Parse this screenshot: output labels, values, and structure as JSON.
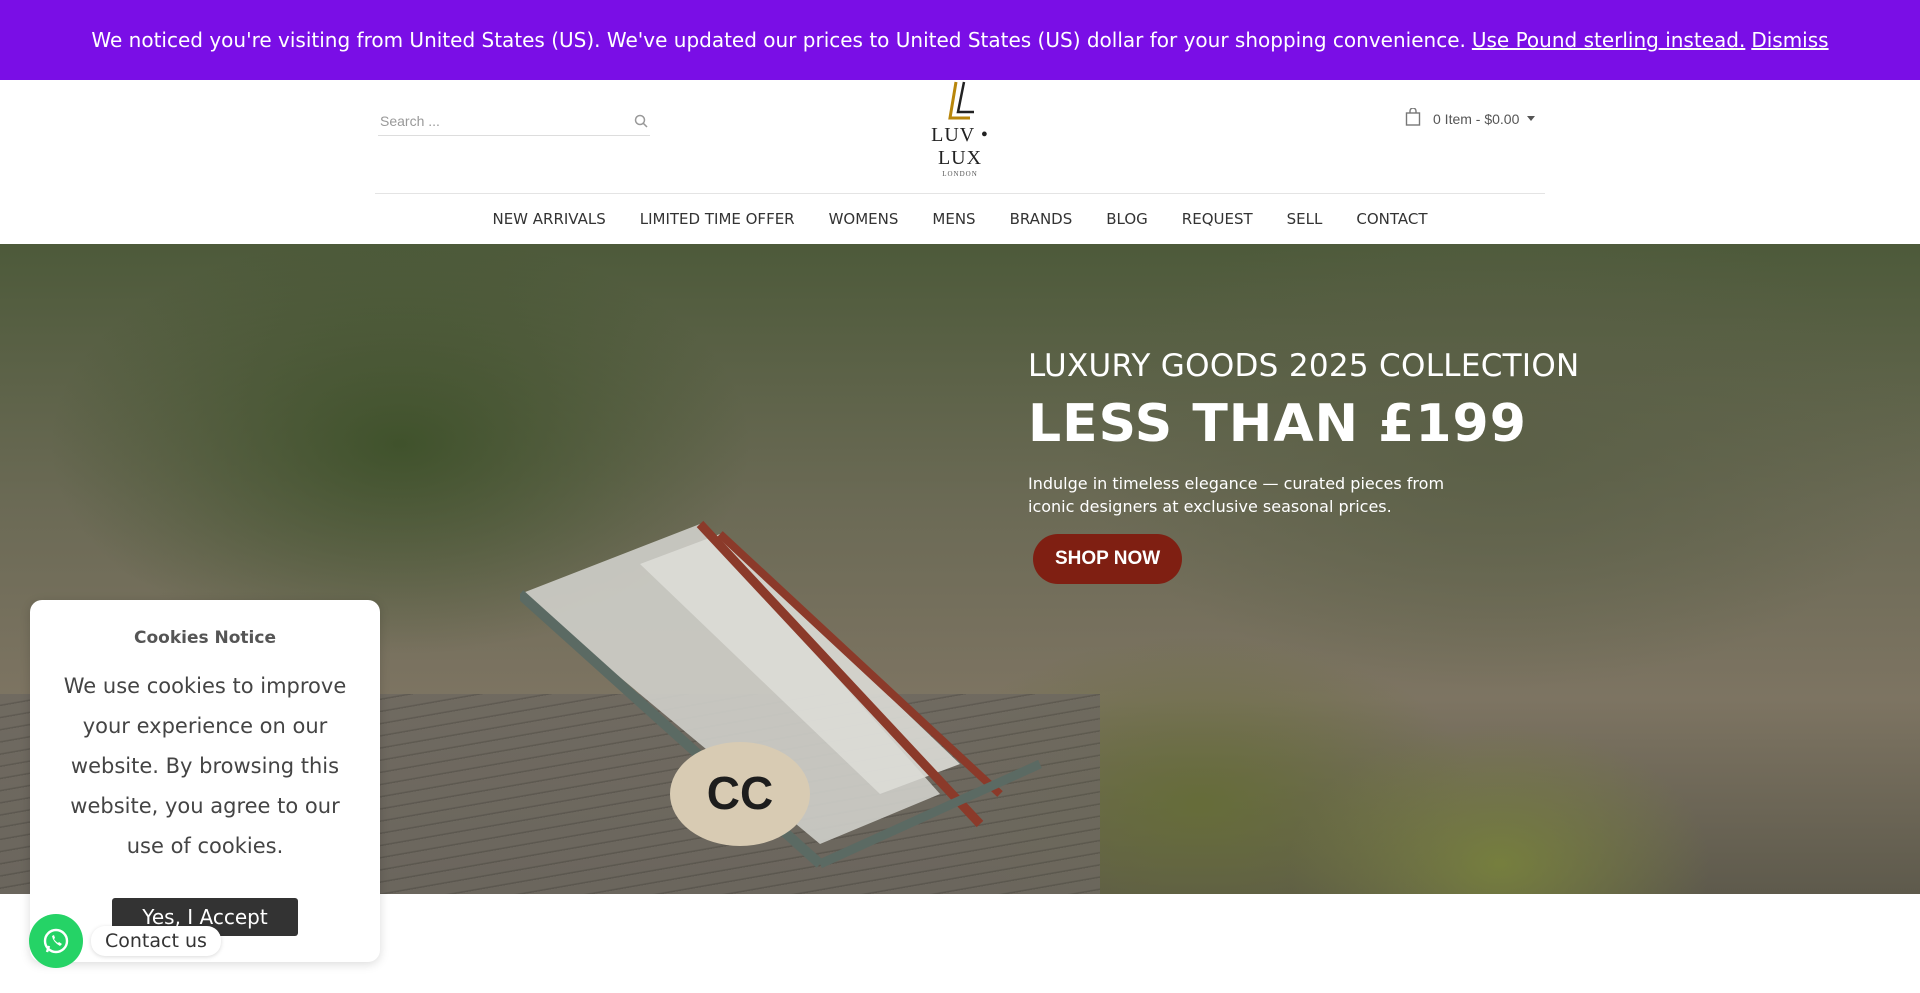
{
  "notice": {
    "message": "We noticed you're visiting from United States (US). We've updated our prices to United States (US) dollar for your shopping convenience.",
    "alt_currency_link": "Use Pound sterling instead.",
    "dismiss_link": "Dismiss",
    "bg_color": "#7a0ee6"
  },
  "header": {
    "search": {
      "placeholder": "Search ..."
    },
    "logo": {
      "name": "LUV • LUX",
      "sub": "LONDON"
    },
    "cart": {
      "summary": "0 Item - $0.00"
    }
  },
  "nav": {
    "items": [
      {
        "label": "NEW ARRIVALS"
      },
      {
        "label": "LIMITED TIME OFFER"
      },
      {
        "label": "WOMENS"
      },
      {
        "label": "MENS"
      },
      {
        "label": "BRANDS"
      },
      {
        "label": "BLOG"
      },
      {
        "label": "REQUEST"
      },
      {
        "label": "SELL"
      },
      {
        "label": "CONTACT"
      }
    ]
  },
  "hero": {
    "kicker": "LUXURY GOODS 2025 COLLECTION",
    "title": "LESS THAN £199",
    "description": "Indulge in timeless elegance — curated pieces from iconic designers at exclusive seasonal prices.",
    "cta_label": "SHOP NOW",
    "cta_color": "#7f1f12"
  },
  "cookies": {
    "title": "Cookies Notice",
    "text": "We use cookies to improve your experience on our website. By browsing this website, you agree to our use of cookies.",
    "accept_label": "Yes, I Accept"
  },
  "contact": {
    "label": "Contact us",
    "icon": "whatsapp-icon"
  }
}
